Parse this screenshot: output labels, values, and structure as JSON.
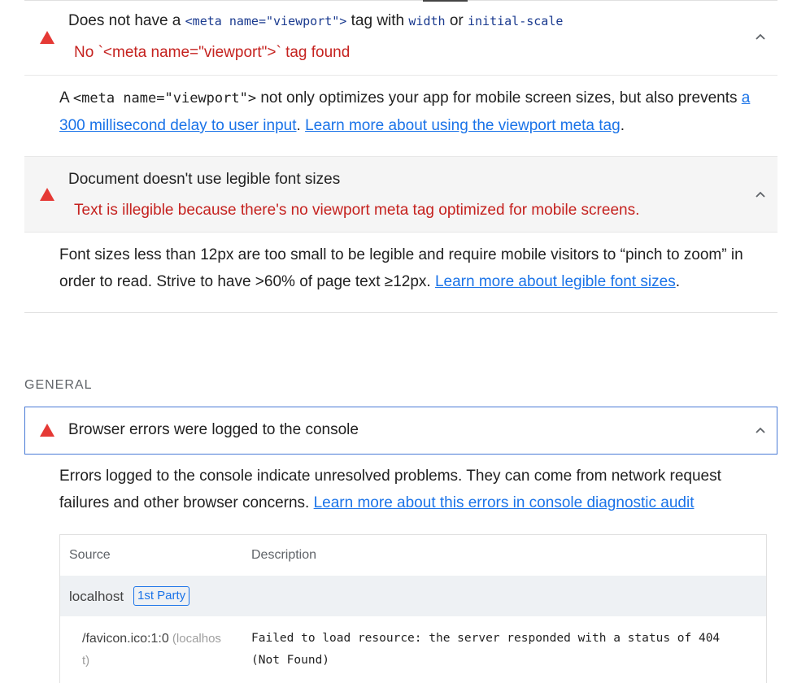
{
  "audit_viewport": {
    "title_prefix": "Does not have a ",
    "title_code_meta": "<meta name=\"viewport\">",
    "title_middle": " tag with ",
    "title_code_width": "width",
    "title_or": " or ",
    "title_code_scale": "initial-scale",
    "display_value": "No `<meta name=\"viewport\">` tag found",
    "desc_prefix": "A ",
    "desc_code": "<meta name=\"viewport\">",
    "desc_middle": " not only optimizes your app for mobile screen sizes, but also prevents ",
    "desc_link1_part1": "a",
    "desc_link1_part2": "300 millisecond delay to user input",
    "desc_sep": ". ",
    "desc_link2": "Learn more about using the viewport meta tag",
    "desc_end": "."
  },
  "audit_font_size": {
    "title": "Document doesn't use legible font sizes",
    "display_value": "Text is illegible because there's no viewport meta tag optimized for mobile screens.",
    "desc_line1": "Font sizes less than 12px are too small to be legible and require mobile visitors to “pinch to zoom” in",
    "desc_line2": "order to read. Strive to have >60% of page text ≥12px. ",
    "desc_link": "Learn more about legible font sizes",
    "desc_end": "."
  },
  "group": {
    "title": "GENERAL"
  },
  "audit_console": {
    "title": "Browser errors were logged to the console",
    "desc_line1": "Errors logged to the console indicate unresolved problems. They can come from network request",
    "desc_line2": "failures and other browser concerns. ",
    "desc_link": "Learn more about this errors in console diagnostic audit",
    "table": {
      "col_source": "Source",
      "col_description": "Description",
      "entity": "localhost",
      "entity_badge": "1st Party",
      "row_source_line1": "/favicon.ico:1:0",
      "row_source_host1": " (localhos",
      "row_source_host2": "t)",
      "row_desc_line1": "Failed to load resource: the server responded with a status of 404",
      "row_desc_line2": "(Not Found)"
    }
  },
  "colors": {
    "warning_red": "#e53935",
    "error_text": "#c5221f",
    "link": "#1a73e8",
    "selected_border": "#4a7bd6"
  },
  "icons": {
    "warning": "warning-triangle-icon",
    "chevron": "chevron-up-icon"
  }
}
